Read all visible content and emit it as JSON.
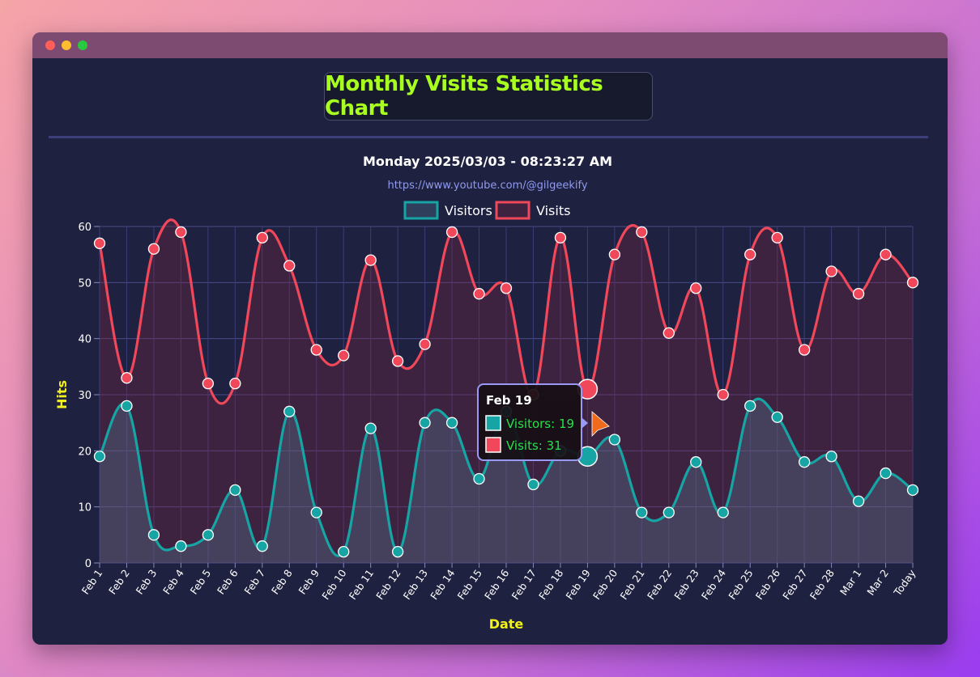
{
  "window": {
    "title": "Monthly Visits Statistics Chart"
  },
  "chart_data": {
    "type": "line",
    "title": "Monday 2025/03/03 - 08:23:27 AM",
    "subtitle": "https://www.youtube.com/@gilgeekify",
    "xlabel": "Date",
    "ylabel": "Hits",
    "ylim": [
      0,
      60
    ],
    "yticks": [
      0,
      10,
      20,
      30,
      40,
      50,
      60
    ],
    "grid": true,
    "legend_position": "top",
    "categories": [
      "Feb 1",
      "Feb 2",
      "Feb 3",
      "Feb 4",
      "Feb 5",
      "Feb 6",
      "Feb 7",
      "Feb 8",
      "Feb 9",
      "Feb 10",
      "Feb 11",
      "Feb 12",
      "Feb 13",
      "Feb 14",
      "Feb 15",
      "Feb 16",
      "Feb 17",
      "Feb 18",
      "Feb 19",
      "Feb 20",
      "Feb 21",
      "Feb 22",
      "Feb 23",
      "Feb 24",
      "Feb 25",
      "Feb 26",
      "Feb 27",
      "Feb 28",
      "Mar 1",
      "Mar 2",
      "Today"
    ],
    "series": [
      {
        "name": "Visitors",
        "color": "#16a4a4",
        "fill": "rgba(90,150,170,0.25)",
        "values": [
          19,
          28,
          5,
          3,
          5,
          13,
          3,
          27,
          9,
          2,
          24,
          2,
          25,
          25,
          15,
          27,
          14,
          20,
          19,
          22,
          9,
          9,
          18,
          9,
          28,
          26,
          18,
          19,
          11,
          16,
          13
        ]
      },
      {
        "name": "Visits",
        "color": "#f0485a",
        "fill": "rgba(120,40,70,0.35)",
        "values": [
          57,
          33,
          56,
          59,
          32,
          32,
          58,
          53,
          38,
          37,
          54,
          36,
          39,
          59,
          48,
          49,
          30,
          58,
          31,
          55,
          59,
          41,
          49,
          30,
          55,
          58,
          38,
          52,
          48,
          55,
          50
        ]
      }
    ],
    "tooltip": {
      "category": "Feb 19",
      "lines": [
        "Visitors: 19",
        "Visits: 31"
      ]
    },
    "colors": {
      "axis_label": "#f2f21a",
      "tick_label": "#ffffff",
      "tooltip_text": "#28e04a",
      "cursor": "#f06a1c"
    }
  }
}
